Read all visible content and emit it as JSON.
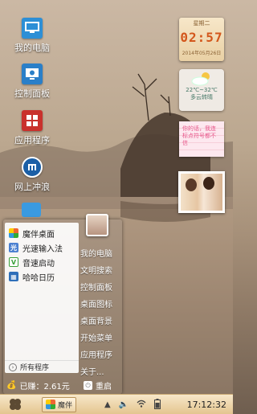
{
  "desktop_icons": [
    {
      "label": "我的电脑",
      "icon": "monitor-icon"
    },
    {
      "label": "控制面板",
      "icon": "control-panel-icon"
    },
    {
      "label": "应用程序",
      "icon": "apps-grid-icon"
    },
    {
      "label": "网上冲浪",
      "icon": "browser-icon"
    }
  ],
  "clock_widget": {
    "day": "星期二",
    "time": "02:57",
    "date": "2014年05月26日"
  },
  "weather_widget": {
    "temp": "22℃~32℃",
    "condition": "多云转晴"
  },
  "note_widget": {
    "text": "你的话，我连标点符号都不信"
  },
  "start_menu": {
    "left_items": [
      {
        "label": "魔伴桌面",
        "icon": "mobanzhuomian-icon",
        "color": "#3a9ad9"
      },
      {
        "label": "光速输入法",
        "icon": "input-method-icon",
        "color": "#4a7fd0"
      },
      {
        "label": "音速启动",
        "icon": "quick-launch-icon",
        "color": "#3aa03a"
      },
      {
        "label": "哈哈日历",
        "icon": "calendar-icon",
        "color": "#2f6fb9"
      }
    ],
    "all_programs": "所有程序",
    "right_items": [
      "我的电脑",
      "文明搜索",
      "控制面板",
      "桌面图标",
      "桌面背景",
      "开始菜单",
      "应用程序",
      "关于..."
    ],
    "earned": "已赚：2.61元",
    "restart": "重启"
  },
  "taskbar": {
    "app_label": "魔伴",
    "time": "17:12:32"
  },
  "colors": {
    "taskbar": "#ecd3a6",
    "accent": "#d3571c"
  }
}
